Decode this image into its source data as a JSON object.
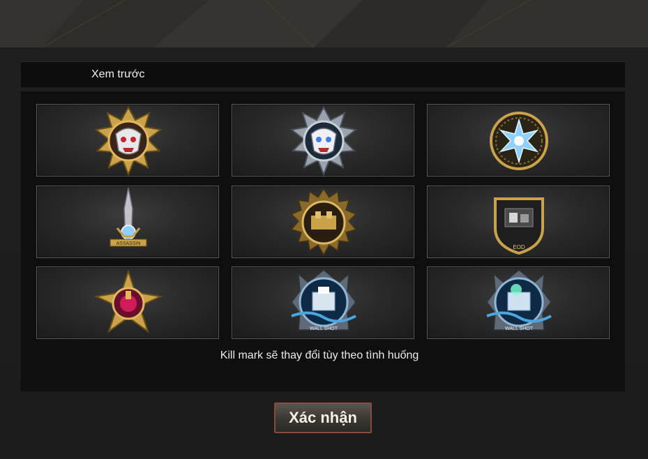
{
  "header": {
    "title": "Xem trước"
  },
  "kill_marks": [
    {
      "icon": "demon-skull-gold-icon"
    },
    {
      "icon": "demon-skull-silver-icon"
    },
    {
      "icon": "ice-star-emblem-icon"
    },
    {
      "icon": "assassin-sword-icon",
      "banner": "ASSASSIN"
    },
    {
      "icon": "spiked-sun-medal-icon"
    },
    {
      "icon": "shield-emblem-icon",
      "banner": "EOD"
    },
    {
      "icon": "cross-medal-ruby-icon"
    },
    {
      "icon": "wall-shot-emblem-icon",
      "banner": "WALL SHOT"
    },
    {
      "icon": "wall-shot-emblem-alt-icon",
      "banner": "WALL SHOT"
    }
  ],
  "note": "Kill mark sẽ thay đổi tùy theo tình huống",
  "confirm_label": "Xác nhận",
  "colors": {
    "button_border": "#8b4a3b",
    "gold": "#c9a24a",
    "ice": "#8fd0ff"
  }
}
